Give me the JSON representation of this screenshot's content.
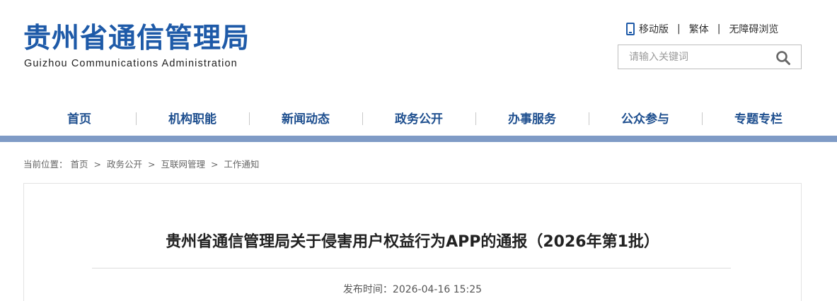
{
  "site": {
    "name_cn": "贵州省通信管理局",
    "name_en": "Guizhou Communications Administration"
  },
  "toplinks": {
    "mobile": "移动版",
    "traditional": "繁体",
    "accessible": "无障碍浏览",
    "separator": "|"
  },
  "search": {
    "placeholder": "请输入关键词",
    "icon": "search-icon"
  },
  "nav": {
    "items": [
      "首页",
      "机构职能",
      "新闻动态",
      "政务公开",
      "办事服务",
      "公众参与",
      "专题专栏"
    ]
  },
  "breadcrumb": {
    "prefix": "当前位置：",
    "items": [
      "首页",
      "政务公开",
      "互联网管理",
      "工作通知"
    ],
    "separator": ">"
  },
  "article": {
    "title": "贵州省通信管理局关于侵害用户权益行为APP的通报（2026年第1批）",
    "publish_label": "发布时间：",
    "publish_time": "2026-04-16 15:25"
  },
  "colors": {
    "brand": "#1e5aa8",
    "nav_text": "#1e4f8f",
    "nav_bar": "#7f9bc6"
  }
}
